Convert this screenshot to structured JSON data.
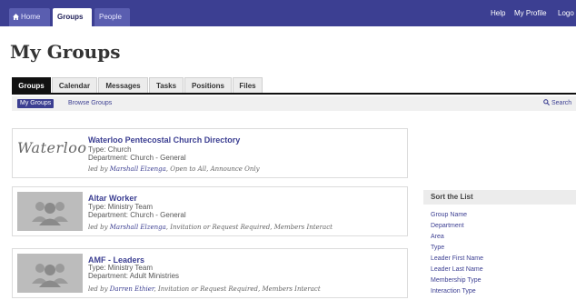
{
  "nav": {
    "tabs": [
      {
        "label": "Home",
        "icon": "home-icon"
      },
      {
        "label": "Groups",
        "active": true
      },
      {
        "label": "People"
      }
    ],
    "links": [
      "Help",
      "My Profile",
      "Logo"
    ]
  },
  "page": {
    "title": "My Groups"
  },
  "subtabs": [
    {
      "label": "Groups",
      "active": true
    },
    {
      "label": "Calendar"
    },
    {
      "label": "Messages"
    },
    {
      "label": "Tasks"
    },
    {
      "label": "Positions"
    },
    {
      "label": "Files"
    }
  ],
  "subnav": {
    "my_groups": "My Groups",
    "browse": "Browse Groups",
    "search": "Search"
  },
  "groups": [
    {
      "logo": "Waterloo",
      "title": "Waterloo Pentecostal Church Directory",
      "type": "Type: Church",
      "department": "Department: Church - General",
      "ledby_prefix": "led by",
      "leader": "Marshall Elzenga",
      "ledby_suffix": ", Open to All, Announce Only"
    },
    {
      "title": "Altar Worker",
      "type": "Type: Ministry Team",
      "department": "Department: Church - General",
      "ledby_prefix": "led by",
      "leader": "Marshall Elzenga",
      "ledby_suffix": ", Invitation or Request Required, Members Interact"
    },
    {
      "title": "AMF - Leaders",
      "type": "Type: Ministry Team",
      "department": "Department: Adult Ministries",
      "ledby_prefix": "led by",
      "leader": "Darren Ethier",
      "ledby_suffix": ", Invitation or Request Required, Members Interact"
    }
  ],
  "sort": {
    "header": "Sort the List",
    "items": [
      "Group Name",
      "Department",
      "Area",
      "Type",
      "Leader First Name",
      "Leader Last Name",
      "Membership Type",
      "Interaction Type"
    ]
  },
  "colors": {
    "nav": "#3c3f92",
    "link": "#3c3f92",
    "subtab_active": "#111111"
  }
}
